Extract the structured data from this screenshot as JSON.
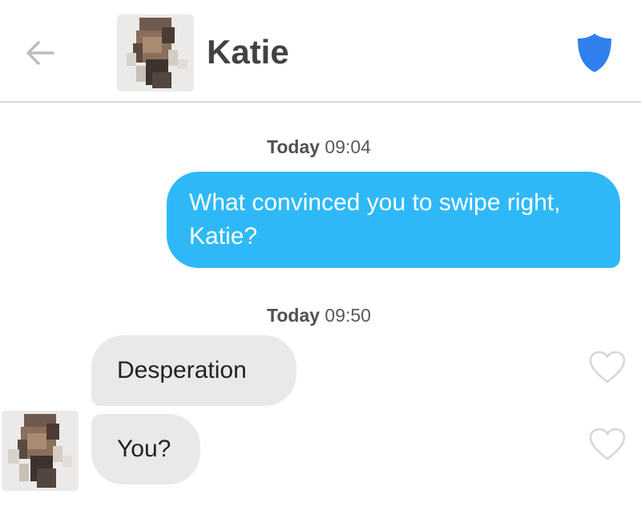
{
  "header": {
    "back_icon": "arrow-left-icon",
    "contact_name": "Katie",
    "shield_icon": "shield-icon",
    "shield_color": "#2f80ed"
  },
  "messages": [
    {
      "timestamp_day": "Today",
      "timestamp_time": "09:04",
      "direction": "outgoing",
      "text": "What convinced you to swipe right, Katie?"
    },
    {
      "timestamp_day": "Today",
      "timestamp_time": "09:50",
      "direction": "incoming",
      "text": "Desperation",
      "like_icon": "heart-outline-icon"
    },
    {
      "direction": "incoming",
      "text": "You?",
      "like_icon": "heart-outline-icon"
    }
  ],
  "colors": {
    "outgoing_bubble": "#2fb8f7",
    "incoming_bubble": "#e9e9e9",
    "timestamp_text": "#555555"
  }
}
